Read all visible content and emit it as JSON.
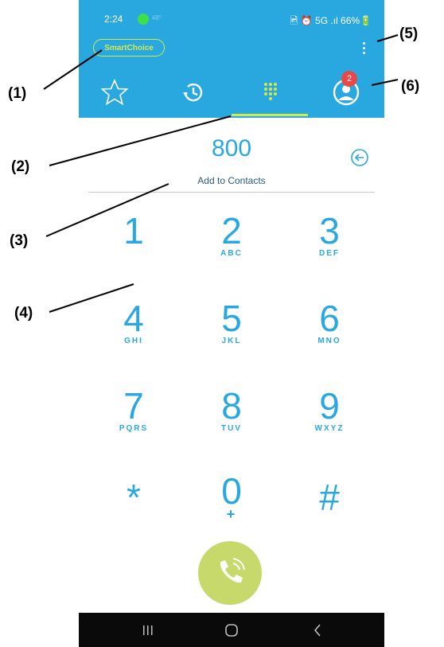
{
  "status": {
    "time": "2:24",
    "temp": "48°",
    "right": "🖻 ⏰ 5G .ıl 66%🔋"
  },
  "header": {
    "badge_label": "SmartChoice"
  },
  "tabs": {
    "contacts_badge": "2"
  },
  "dialer": {
    "number": "800",
    "add_to_contacts": "Add to Contacts",
    "keys": [
      {
        "digit": "1",
        "letters": ""
      },
      {
        "digit": "2",
        "letters": "ABC"
      },
      {
        "digit": "3",
        "letters": "DEF"
      },
      {
        "digit": "4",
        "letters": "GHI"
      },
      {
        "digit": "5",
        "letters": "JKL"
      },
      {
        "digit": "6",
        "letters": "MNO"
      },
      {
        "digit": "7",
        "letters": "PQRS"
      },
      {
        "digit": "8",
        "letters": "TUV"
      },
      {
        "digit": "9",
        "letters": "WXYZ"
      },
      {
        "digit": "*",
        "letters": ""
      },
      {
        "digit": "0",
        "letters": "+"
      },
      {
        "digit": "#",
        "letters": ""
      }
    ]
  },
  "callouts": {
    "c1": "(1)",
    "c2": "(2)",
    "c3": "(3)",
    "c4": "(4)",
    "c5": "(5)",
    "c6": "(6)"
  },
  "colors": {
    "primary": "#29a8e0",
    "accent": "#d4e84a",
    "call": "#c7d96a",
    "badge": "#e84848"
  },
  "icons": {
    "favorites": "star-icon",
    "recents": "history-icon",
    "keypad": "keypad-icon",
    "contacts": "contact-icon",
    "menu": "kebab-menu-icon",
    "backspace": "backspace-icon",
    "call": "phone-icon"
  }
}
